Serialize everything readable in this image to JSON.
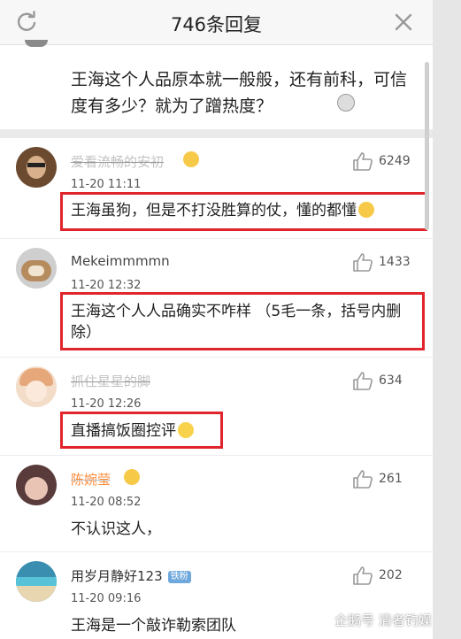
{
  "header": {
    "title": "746条回复",
    "refresh_icon": "refresh-icon",
    "close_icon": "close-icon"
  },
  "top_comment": {
    "text": "王海这个人品原本就一般般，还有前科，可信度有多少？就为了蹭热度？"
  },
  "comments": [
    {
      "username": "爱看流畅的安初",
      "time": "11-20 11:11",
      "likes": "6249",
      "text": "王海虽狗，但是不打没胜算的仗，懂的都懂",
      "highlighted": true,
      "avatar_color": "#6b4a2f"
    },
    {
      "username": "Mekeimmmmn",
      "time": "11-20 12:32",
      "likes": "1433",
      "text": "王海这个人人品确实不咋样 （5毛一条，括号内删除）",
      "highlighted": true,
      "avatar_color": "#b68b5e"
    },
    {
      "username": "抓住星星的脚",
      "time": "11-20 12:26",
      "likes": "634",
      "text": "直播搞饭圈控评",
      "highlighted": true,
      "avatar_color": "#e8c9a9"
    },
    {
      "username": "陈婉莹",
      "time": "11-20 08:52",
      "likes": "261",
      "text": "不认识这人，",
      "highlighted": false,
      "avatar_color": "#5a3b3b"
    },
    {
      "username": "用岁月静好123",
      "badge": "铁粉",
      "time": "11-20 09:16",
      "likes": "202",
      "text": "王海是一个敲诈勒索团队",
      "highlighted": false,
      "avatar_color": "#3a8fb0"
    }
  ],
  "watermark": "企鹅号 清者钓娱",
  "colors": {
    "highlight_border": "#e0262c",
    "background": "#f2f2f2",
    "badge": "#6fa8dc"
  }
}
